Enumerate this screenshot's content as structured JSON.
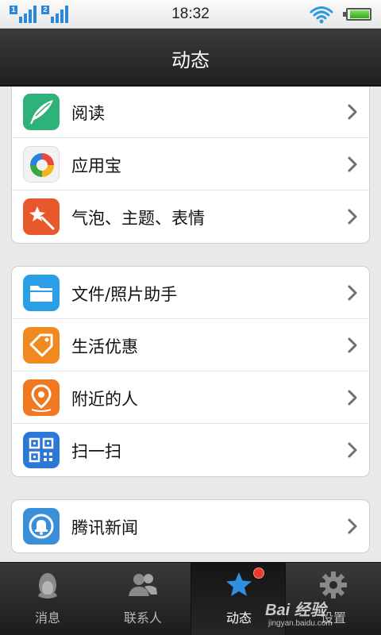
{
  "status_bar": {
    "sim1": "1",
    "sim2": "2",
    "time": "18:32",
    "wifi_icon": "wifi-icon",
    "battery_icon": "battery-icon",
    "battery_level": 0.9
  },
  "header": {
    "title": "动态"
  },
  "cards": [
    {
      "items": [
        {
          "label": "阅读",
          "icon": "reading-feather-icon",
          "color": "#2fb27a"
        },
        {
          "label": "应用宝",
          "icon": "app-store-icon",
          "color": "#f2f2f2"
        },
        {
          "label": "气泡、主题、表情",
          "icon": "magic-wand-icon",
          "color": "#e9582c"
        }
      ]
    },
    {
      "items": [
        {
          "label": "文件/照片助手",
          "icon": "folder-icon",
          "color": "#2a9fe6"
        },
        {
          "label": "生活优惠",
          "icon": "tag-icon",
          "color": "#f08a1e"
        },
        {
          "label": "附近的人",
          "icon": "location-pin-icon",
          "color": "#f07820"
        },
        {
          "label": "扫一扫",
          "icon": "qr-code-icon",
          "color": "#2b78d6"
        }
      ]
    },
    {
      "items": [
        {
          "label": "腾讯新闻",
          "icon": "news-bell-icon",
          "color": "#3b8fd8"
        }
      ]
    }
  ],
  "tabs": [
    {
      "label": "消息",
      "icon": "penguin-icon",
      "active": false
    },
    {
      "label": "联系人",
      "icon": "contacts-icon",
      "active": false
    },
    {
      "label": "动态",
      "icon": "star-icon",
      "active": true,
      "has_badge": true
    },
    {
      "label": "设置",
      "icon": "gear-icon",
      "active": false
    }
  ],
  "watermark": {
    "brand": "Bai 经验",
    "url": "jingyan.baidu.com"
  },
  "colors": {
    "title_bar": "#2b2b2b",
    "tab_bar": "#2a2a2a",
    "badge": "#ea3b2e",
    "signal": "#2b88d8"
  }
}
